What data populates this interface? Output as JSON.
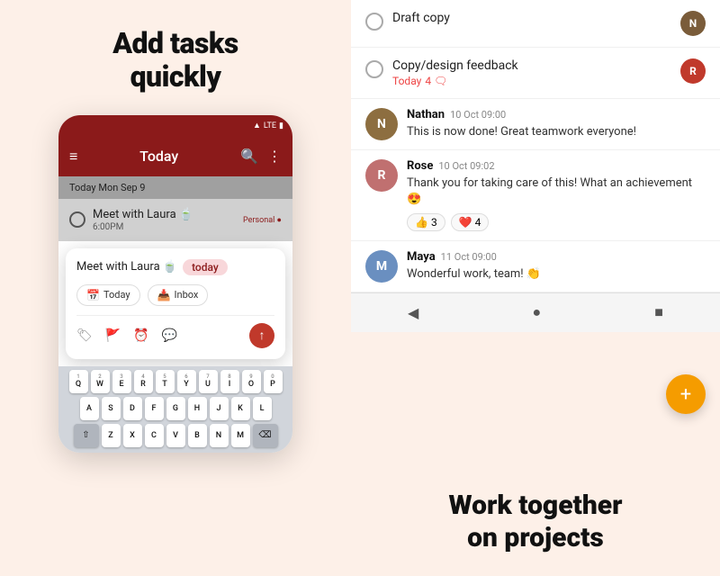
{
  "left": {
    "title": "Add tasks\nquickly",
    "phone": {
      "toolbar_title": "Today",
      "date_label": "Today",
      "date_value": "Mon Sep 9",
      "task_name": "Meet with Laura 🍵",
      "task_time": "6:00PM",
      "task_label": "Personal ●",
      "quick_add_text": "Meet with Laura 🍵",
      "quick_add_badge": "today",
      "btn1_label": "Today",
      "btn2_label": "Inbox",
      "keyboard_rows": [
        [
          "Q",
          "W",
          "E",
          "R",
          "T",
          "Y",
          "U",
          "I",
          "O",
          "P"
        ],
        [
          "A",
          "S",
          "D",
          "F",
          "G",
          "H",
          "J",
          "K",
          "L"
        ],
        [
          "Z",
          "X",
          "C",
          "V",
          "B",
          "N",
          "M"
        ]
      ],
      "key_nums": [
        "1",
        "2",
        "3",
        "4",
        "5",
        "6",
        "7",
        "8",
        "9",
        "0",
        "",
        "",
        "",
        "",
        "",
        "",
        "",
        "",
        "",
        "",
        "",
        "",
        "",
        "",
        "",
        "",
        "",
        "",
        ""
      ]
    }
  },
  "right": {
    "tasks": [
      {
        "name": "Draft copy",
        "avatar_color": "av-brown",
        "avatar_text": "N"
      },
      {
        "name": "Copy/design feedback",
        "meta": "Today",
        "meta2": "4 🗨",
        "avatar_color": "av-red",
        "avatar_text": "R"
      }
    ],
    "messages": [
      {
        "name": "Nathan",
        "time": "10 Oct 09:00",
        "text": "This is now done! Great teamwork everyone!",
        "avatar_color": "av-nathan",
        "avatar_text": "N"
      },
      {
        "name": "Rose",
        "time": "10 Oct 09:02",
        "text": "Thank you for taking care of this! What an achievement 😍",
        "avatar_color": "av-rose",
        "avatar_text": "R",
        "reactions": [
          {
            "emoji": "👍",
            "count": "3"
          },
          {
            "emoji": "❤️",
            "count": "4"
          }
        ]
      },
      {
        "name": "Maya",
        "time": "11 Oct 09:00",
        "text": "Wonderful work, team! 👏",
        "avatar_color": "av-maya",
        "avatar_text": "M"
      }
    ],
    "bottom_title": "Work together\non projects",
    "fab_icon": "+",
    "nav_icons": [
      "◀",
      "●",
      "■"
    ]
  }
}
